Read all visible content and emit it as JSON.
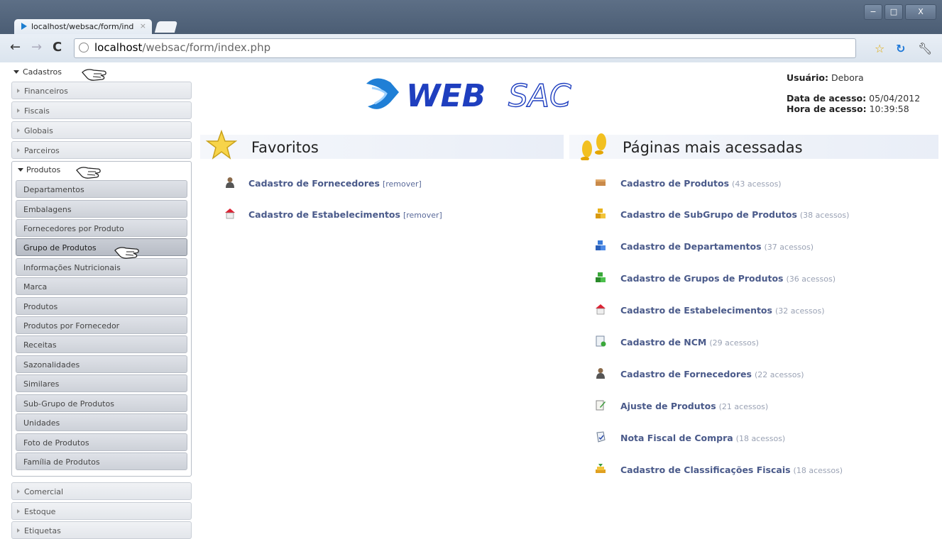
{
  "browser": {
    "tab_title": "localhost/websac/form/ind",
    "url_host": "localhost",
    "url_path": "/websac/form/index.php",
    "window_controls": [
      "−",
      "□",
      "X"
    ]
  },
  "sidebar": {
    "cadastros_label": "Cadastros",
    "groups_before": [
      "Financeiros",
      "Fiscais",
      "Globais",
      "Parceiros"
    ],
    "produtos_label": "Produtos",
    "produtos_items": [
      "Departamentos",
      "Embalagens",
      "Fornecedores por Produto",
      "Grupo de Produtos",
      "Informações Nutricionais",
      "Marca",
      "Produtos",
      "Produtos por Fornecedor",
      "Receitas",
      "Sazonalidades",
      "Similares",
      "Sub-Grupo de Produtos",
      "Unidades",
      "Foto de Produtos",
      "Família de Produtos"
    ],
    "active_item": "Grupo de Produtos",
    "groups_after": [
      "Comercial",
      "Estoque",
      "Etiquetas"
    ]
  },
  "header": {
    "logo_text_1": "WEB",
    "logo_text_2": "SAC",
    "usuario_label": "Usuário:",
    "usuario_value": "Debora",
    "data_label": "Data de acesso:",
    "data_value": "05/04/2012",
    "hora_label": "Hora de acesso:",
    "hora_value": "10:39:58"
  },
  "favoritos": {
    "title": "Favoritos",
    "remove_label": "[remover]",
    "items": [
      {
        "label": "Cadastro de Fornecedores",
        "icon": "person-icon"
      },
      {
        "label": "Cadastro de Estabelecimentos",
        "icon": "house-icon"
      }
    ]
  },
  "mais_acessadas": {
    "title": "Páginas mais acessadas",
    "items": [
      {
        "label": "Cadastro de Produtos",
        "count": "(43 acessos)",
        "icon": "box-icon"
      },
      {
        "label": "Cadastro de SubGrupo de Produtos",
        "count": "(38 acessos)",
        "icon": "yellow-blocks-icon"
      },
      {
        "label": "Cadastro de Departamentos",
        "count": "(37 acessos)",
        "icon": "blue-blocks-icon"
      },
      {
        "label": "Cadastro de Grupos de Produtos",
        "count": "(36 acessos)",
        "icon": "green-blocks-icon"
      },
      {
        "label": "Cadastro de Estabelecimentos",
        "count": "(32 acessos)",
        "icon": "house-icon"
      },
      {
        "label": "Cadastro de NCM",
        "count": "(29 acessos)",
        "icon": "document-check-icon"
      },
      {
        "label": "Cadastro de Fornecedores",
        "count": "(22 acessos)",
        "icon": "person-icon"
      },
      {
        "label": "Ajuste de Produtos",
        "count": "(21 acessos)",
        "icon": "edit-icon"
      },
      {
        "label": "Nota Fiscal de Compra",
        "count": "(18 acessos)",
        "icon": "invoice-icon"
      },
      {
        "label": "Cadastro de Classificações Fiscais",
        "count": "(18 acessos)",
        "icon": "stack-icon"
      }
    ]
  },
  "colors": {
    "link": "#4a5a8a",
    "count": "#9aa2b4",
    "logo_blue": "#1f3fbf"
  }
}
